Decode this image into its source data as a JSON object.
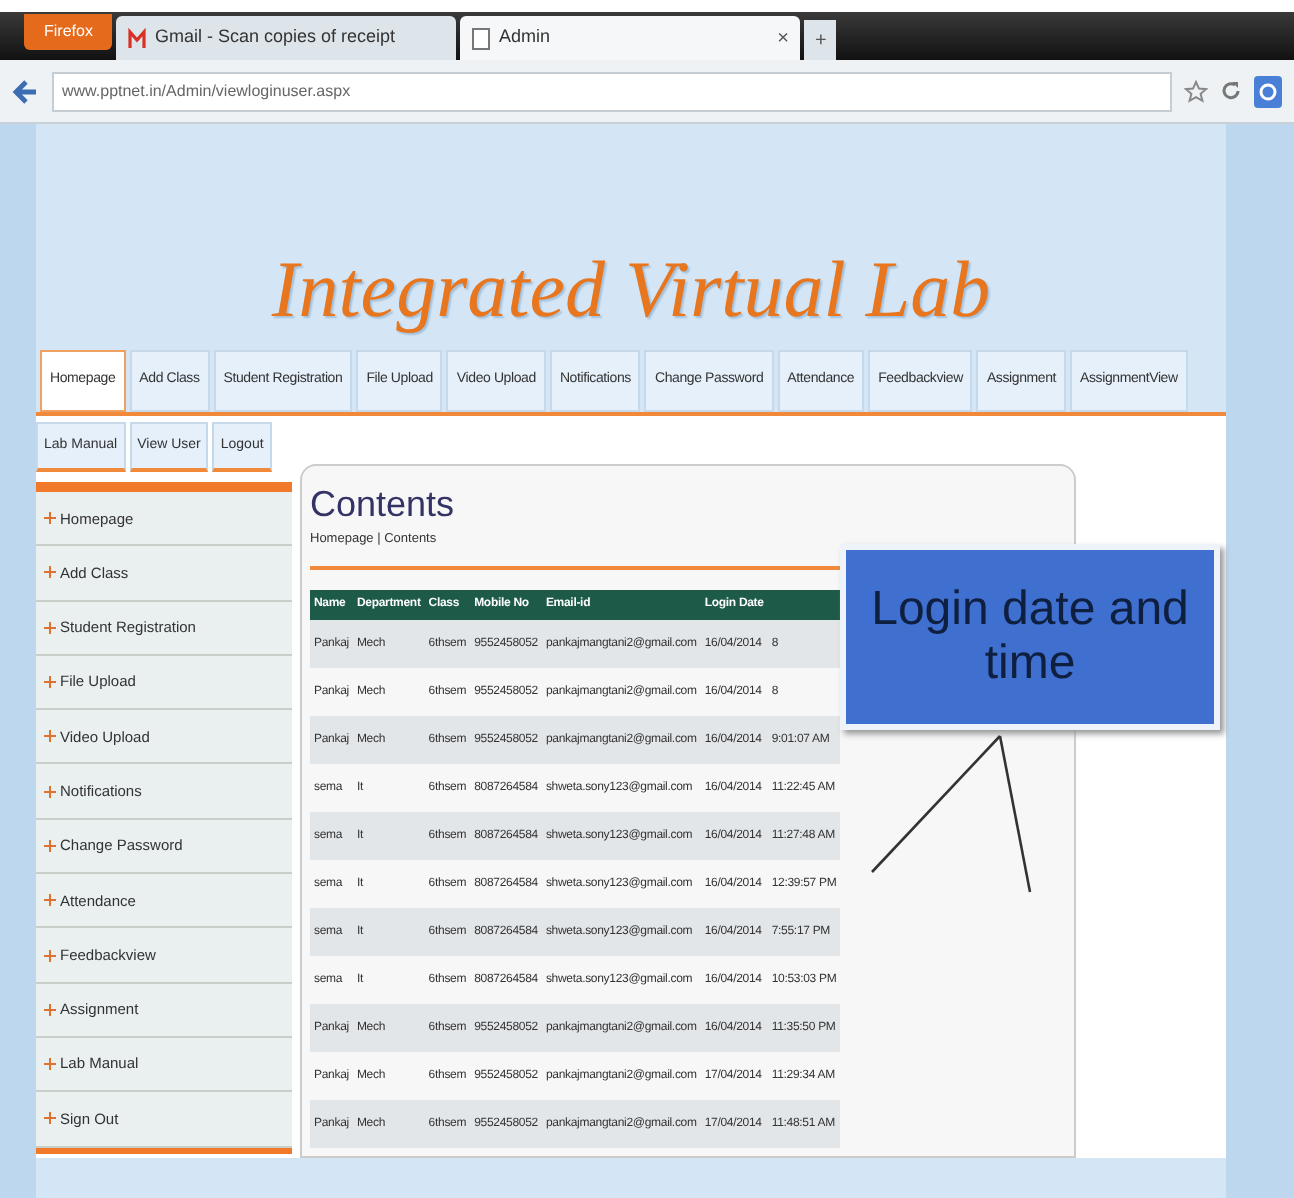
{
  "browser": {
    "menu_button": "Firefox",
    "tabs": [
      {
        "title": "Gmail - Scan copies of receipt",
        "selected": false
      },
      {
        "title": "Admin",
        "selected": true
      }
    ],
    "close_tab": "×",
    "new_tab": "+",
    "address": "www.pptnet.in/Admin/viewloginuser.aspx"
  },
  "site_title": "Integrated Virtual Lab",
  "nav_tabs": [
    {
      "label": "Homepage",
      "selected": true
    },
    {
      "label": "Add Class",
      "selected": false
    },
    {
      "label": "Student Registration",
      "selected": false
    },
    {
      "label": "File Upload",
      "selected": false
    },
    {
      "label": "Video Upload",
      "selected": false
    },
    {
      "label": "Notifications",
      "selected": false
    },
    {
      "label": "Change Password",
      "selected": false
    },
    {
      "label": "Attendance",
      "selected": false
    },
    {
      "label": "Feedbackview",
      "selected": false
    },
    {
      "label": "Assignment",
      "selected": false
    },
    {
      "label": "AssignmentView",
      "selected": false
    }
  ],
  "sub_tabs": [
    "Lab Manual",
    "View User",
    "Logout"
  ],
  "sidebar": {
    "items": [
      "Homepage",
      "Add Class",
      "Student Registration",
      "File Upload",
      "Video Upload",
      "Notifications",
      "Change Password",
      "Attendance",
      "Feedbackview",
      "Assignment",
      "Lab Manual",
      "Sign Out"
    ]
  },
  "content": {
    "heading": "Contents",
    "breadcrumb": "Homepage | Contents"
  },
  "table": {
    "columns": [
      "Name",
      "Department",
      "Class",
      "Mobile No",
      "Email-id",
      "Login Date",
      ""
    ],
    "rows": [
      [
        "Pankaj",
        "Mech",
        "6thsem",
        "9552458052",
        "pankajmangtani2@gmail.com",
        "16/04/2014",
        "8"
      ],
      [
        "Pankaj",
        "Mech",
        "6thsem",
        "9552458052",
        "pankajmangtani2@gmail.com",
        "16/04/2014",
        "8"
      ],
      [
        "Pankaj",
        "Mech",
        "6thsem",
        "9552458052",
        "pankajmangtani2@gmail.com",
        "16/04/2014",
        "9:01:07 AM"
      ],
      [
        "sema",
        "It",
        "6thsem",
        "8087264584",
        "shweta.sony123@gmail.com",
        "16/04/2014",
        "11:22:45 AM"
      ],
      [
        "sema",
        "It",
        "6thsem",
        "8087264584",
        "shweta.sony123@gmail.com",
        "16/04/2014",
        "11:27:48 AM"
      ],
      [
        "sema",
        "It",
        "6thsem",
        "8087264584",
        "shweta.sony123@gmail.com",
        "16/04/2014",
        "12:39:57 PM"
      ],
      [
        "sema",
        "It",
        "6thsem",
        "8087264584",
        "shweta.sony123@gmail.com",
        "16/04/2014",
        "7:55:17 PM"
      ],
      [
        "sema",
        "It",
        "6thsem",
        "8087264584",
        "shweta.sony123@gmail.com",
        "16/04/2014",
        "10:53:03 PM"
      ],
      [
        "Pankaj",
        "Mech",
        "6thsem",
        "9552458052",
        "pankajmangtani2@gmail.com",
        "16/04/2014",
        "11:35:50 PM"
      ],
      [
        "Pankaj",
        "Mech",
        "6thsem",
        "9552458052",
        "pankajmangtani2@gmail.com",
        "17/04/2014",
        "11:29:34 AM"
      ],
      [
        "Pankaj",
        "Mech",
        "6thsem",
        "9552458052",
        "pankajmangtani2@gmail.com",
        "17/04/2014",
        "11:48:51 AM"
      ]
    ]
  },
  "callout": {
    "text": "Login date and time"
  }
}
